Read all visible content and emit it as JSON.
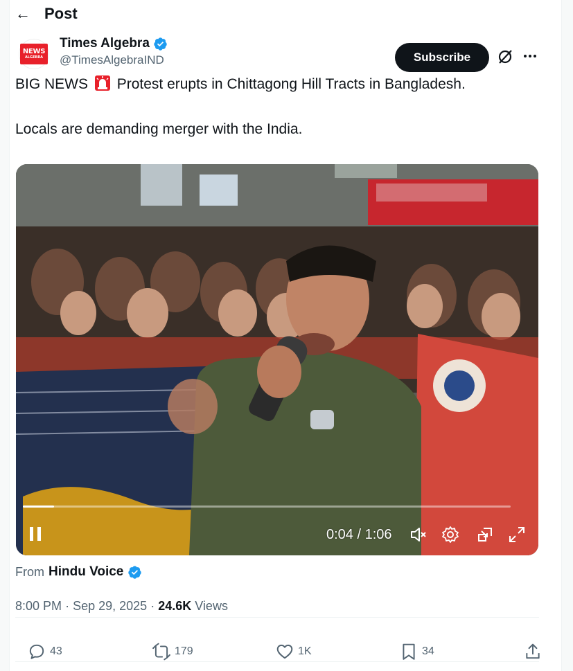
{
  "header": {
    "title": "Post"
  },
  "author": {
    "name": "Times Algebra",
    "handle": "@TimesAlgebraIND",
    "avatar_logo_top": "NEWS",
    "avatar_logo_bottom": "ALGEBRA"
  },
  "actions_top": {
    "subscribe_label": "Subscribe"
  },
  "tweet": {
    "line1_before": "BIG NEWS",
    "line1_after": "Protest erupts in Chittagong Hill Tracts in Bangladesh.",
    "line2": "Locals are demanding merger with the India."
  },
  "video": {
    "time": "0:04 / 1:06",
    "progress": 0.064
  },
  "source": {
    "from_label": "From",
    "from_name": "Hindu Voice"
  },
  "meta": {
    "time": "8:00 PM",
    "date": "Sep 29, 2025",
    "views_count": "24.6K",
    "views_label": "Views"
  },
  "engagement": {
    "replies": "43",
    "reposts": "179",
    "likes": "1K",
    "bookmarks": "34"
  },
  "colors": {
    "accent": "#1d9bf0",
    "text": "#0f1419",
    "secondary": "#536471"
  },
  "icons": [
    "back-arrow-icon",
    "verified-badge-icon",
    "grok-icon",
    "more-icon",
    "siren-icon",
    "pause-icon",
    "mute-icon",
    "settings-icon",
    "pip-icon",
    "fullscreen-icon",
    "reply-icon",
    "repost-icon",
    "like-icon",
    "bookmark-icon",
    "share-icon"
  ]
}
